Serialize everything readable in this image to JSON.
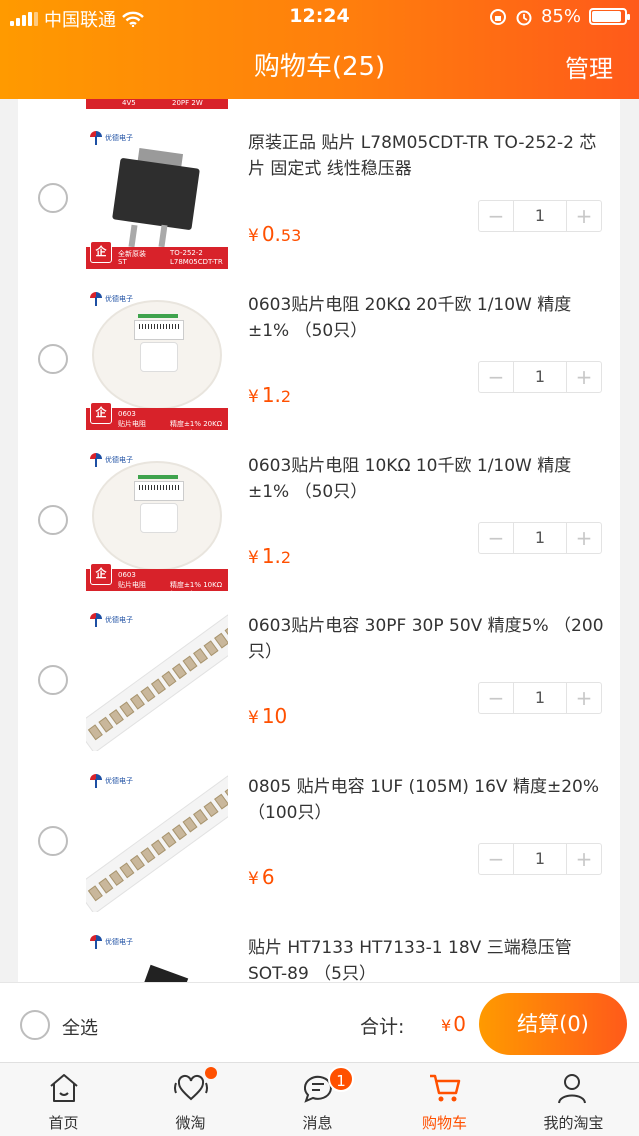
{
  "status_bar": {
    "carrier": "中国联通",
    "time": "12:24",
    "battery": "85%",
    "battery_level": 0.85
  },
  "nav": {
    "title": "购物车(25)",
    "manage": "管理"
  },
  "items": [
    {
      "title": "原装正品 贴片 L78M05CDT-TR TO-252-2 芯片 固定式 线性稳压器",
      "currency": "¥",
      "price_int": "0.",
      "price_dec": "53",
      "quantity": "1",
      "thumb": "regulator-chip",
      "banner": {
        "badge": "企",
        "l1": "全新原装",
        "l2": "ST",
        "r1": "TO-252-2",
        "r2": "L78M05CDT-TR"
      }
    },
    {
      "title": "0603贴片电阻 20KΩ 20千欧 1/10W 精度±1% （50只）",
      "currency": "¥",
      "price_int": "1.",
      "price_dec": "2",
      "quantity": "1",
      "thumb": "resistor-reel",
      "banner": {
        "badge": "企",
        "l1": "0603",
        "l2": "贴片电阻",
        "r1": "",
        "r2": "精度±1% 20KΩ (2002)"
      }
    },
    {
      "title": "0603贴片电阻 10KΩ 10千欧 1/10W 精度±1% （50只）",
      "currency": "¥",
      "price_int": "1.",
      "price_dec": "2",
      "quantity": "1",
      "thumb": "resistor-reel",
      "banner": {
        "badge": "企",
        "l1": "0603",
        "l2": "贴片电阻",
        "r1": "",
        "r2": "精度±1% 10KΩ (1002)"
      }
    },
    {
      "title": "0603贴片电容 30PF 30P 50V  精度5% （200只）",
      "currency": "¥",
      "price_int": "10",
      "price_dec": "",
      "quantity": "1",
      "thumb": "capacitor-tape"
    },
    {
      "title": "0805 贴片电容 1UF (105M) 16V 精度±20% （100只）",
      "currency": "¥",
      "price_int": "6",
      "price_dec": "",
      "quantity": "1",
      "thumb": "capacitor-tape"
    },
    {
      "title": "贴片 HT7133 HT7133-1 18V 三端稳压管 SOT-89 （5只）",
      "currency": "",
      "price_int": "",
      "price_dec": "",
      "quantity": "",
      "thumb": "partial"
    }
  ],
  "partial_top_item": {
    "left": "4V5",
    "right": "20PF 2W"
  },
  "thumb_brand": "优德电子",
  "stepper": {
    "minus": "−",
    "plus": "+"
  },
  "bottom": {
    "select_all": "全选",
    "total_label": "合计:",
    "total_currency": "¥",
    "total_value": "0",
    "checkout": "结算(0)"
  },
  "tabs": [
    {
      "label": "首页",
      "icon": "home-icon"
    },
    {
      "label": "微淘",
      "icon": "heart-wave-icon"
    },
    {
      "label": "消息",
      "icon": "message-icon"
    },
    {
      "label": "购物车",
      "icon": "cart-icon"
    },
    {
      "label": "我的淘宝",
      "icon": "user-icon"
    }
  ],
  "message_badge": "1",
  "colors": {
    "accent": "#ff5000",
    "header_start": "#ff9a00",
    "header_end": "#ff5a1a"
  }
}
